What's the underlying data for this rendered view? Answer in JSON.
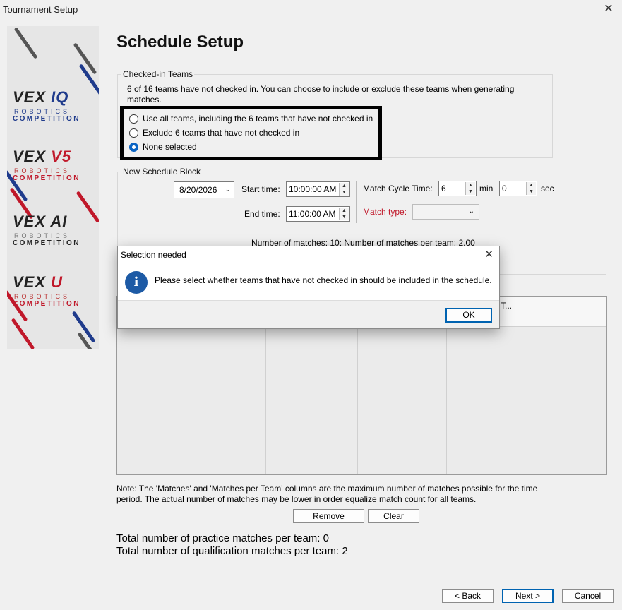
{
  "window": {
    "title": "Tournament Setup"
  },
  "sidebar": {
    "logos": [
      {
        "brand": "VEX",
        "product": "IQ",
        "robotics": "ROBOTICS",
        "competition": "COMPETITION",
        "color": "#1f3b8c"
      },
      {
        "brand": "VEX",
        "product": "V5",
        "robotics": "ROBOTICS",
        "competition": "COMPETITION",
        "color": "#c0182a"
      },
      {
        "brand": "VEX",
        "product": "AI",
        "robotics": "ROBOTICS",
        "competition": "COMPETITION",
        "color": "#222222"
      },
      {
        "brand": "VEX",
        "product": "U",
        "robotics": "ROBOTICS",
        "competition": "COMPETITION",
        "color": "#c0182a"
      }
    ]
  },
  "page": {
    "title": "Schedule Setup"
  },
  "checked_in": {
    "label": "Checked-in Teams",
    "description": "6 of 16 teams have not checked in. You can choose to include or exclude these teams when generating matches.",
    "options": [
      {
        "label": "Use all teams, including the 6 teams that have not checked in",
        "checked": false
      },
      {
        "label": "Exclude 6 teams that have not checked in",
        "checked": false
      },
      {
        "label": "None selected",
        "checked": true
      }
    ]
  },
  "schedule_block": {
    "label": "New Schedule Block",
    "date": "8/20/2026",
    "start_label": "Start time:",
    "start_time": "10:00:00 AM",
    "end_label": "End time:",
    "end_time": "11:00:00 AM",
    "cycle_label": "Match Cycle Time:",
    "cycle_min": "6",
    "min_label": "min",
    "cycle_sec": "0",
    "sec_label": "sec",
    "match_type_label": "Match type:",
    "match_type_value": "",
    "summary": "Number of matches: 10; Number of matches per team: 2.00"
  },
  "grid": {
    "partial_header": "T..."
  },
  "dialog": {
    "title": "Selection needed",
    "message": "Please select whether teams that have not checked in should be included in the schedule.",
    "ok": "OK"
  },
  "note": "Note: The 'Matches' and 'Matches per Team' columns are the maximum number of matches possible for the time period.  The actual number of matches may be lower in order equalize match count for all teams.",
  "actions": {
    "remove": "Remove",
    "clear": "Clear"
  },
  "totals": {
    "practice": "Total number of practice matches per team: 0",
    "qualification": "Total number of qualification matches per team: 2"
  },
  "nav": {
    "back": "< Back",
    "next": "Next >",
    "cancel": "Cancel"
  },
  "colors": {
    "accent": "#0063b1",
    "match_type_label": "#c0182a",
    "highlight_border": "#000000"
  }
}
